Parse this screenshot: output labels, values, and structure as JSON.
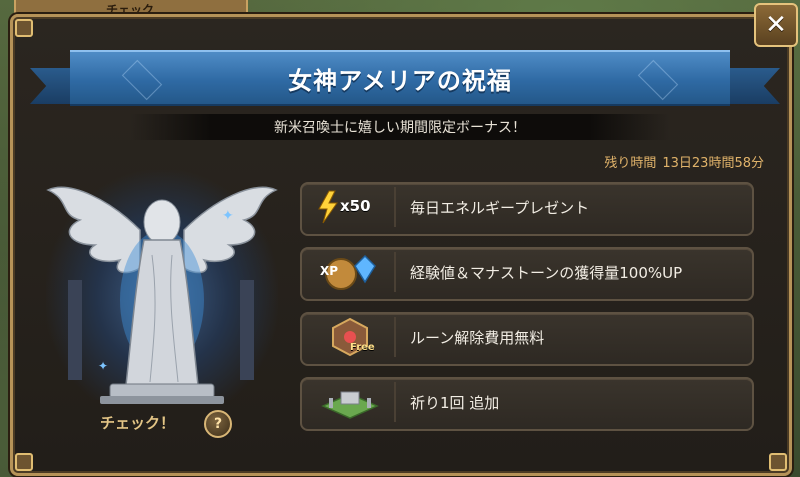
{
  "background_tab": {
    "label": "チェック"
  },
  "dialog": {
    "title": "女神アメリアの祝福",
    "subtitle": "新米召喚士に嬉しい期間限定ボーナス！",
    "timer_label": "残り時間",
    "timer_value": "13日23時間58分",
    "close_icon": "close-x-icon"
  },
  "statue": {
    "icon": "goddess-statue-icon",
    "check_label": "チェック！",
    "help_label": "?"
  },
  "bonuses": [
    {
      "icon": "energy-bolt-icon",
      "badge": "x50",
      "label": "毎日エネルギープレゼント"
    },
    {
      "icon": "xp-mana-stone-icon",
      "badge": "XP",
      "label": "経験値＆マナストーンの獲得量100%UP"
    },
    {
      "icon": "rune-free-icon",
      "badge": "Free",
      "label": "ルーン解除費用無料"
    },
    {
      "icon": "altar-island-icon",
      "badge": "",
      "label": "祈り1回 追加"
    }
  ],
  "colors": {
    "ribbon": "#2f6aa4",
    "frame_border": "#b69358",
    "timer_text": "#e0b36a"
  }
}
